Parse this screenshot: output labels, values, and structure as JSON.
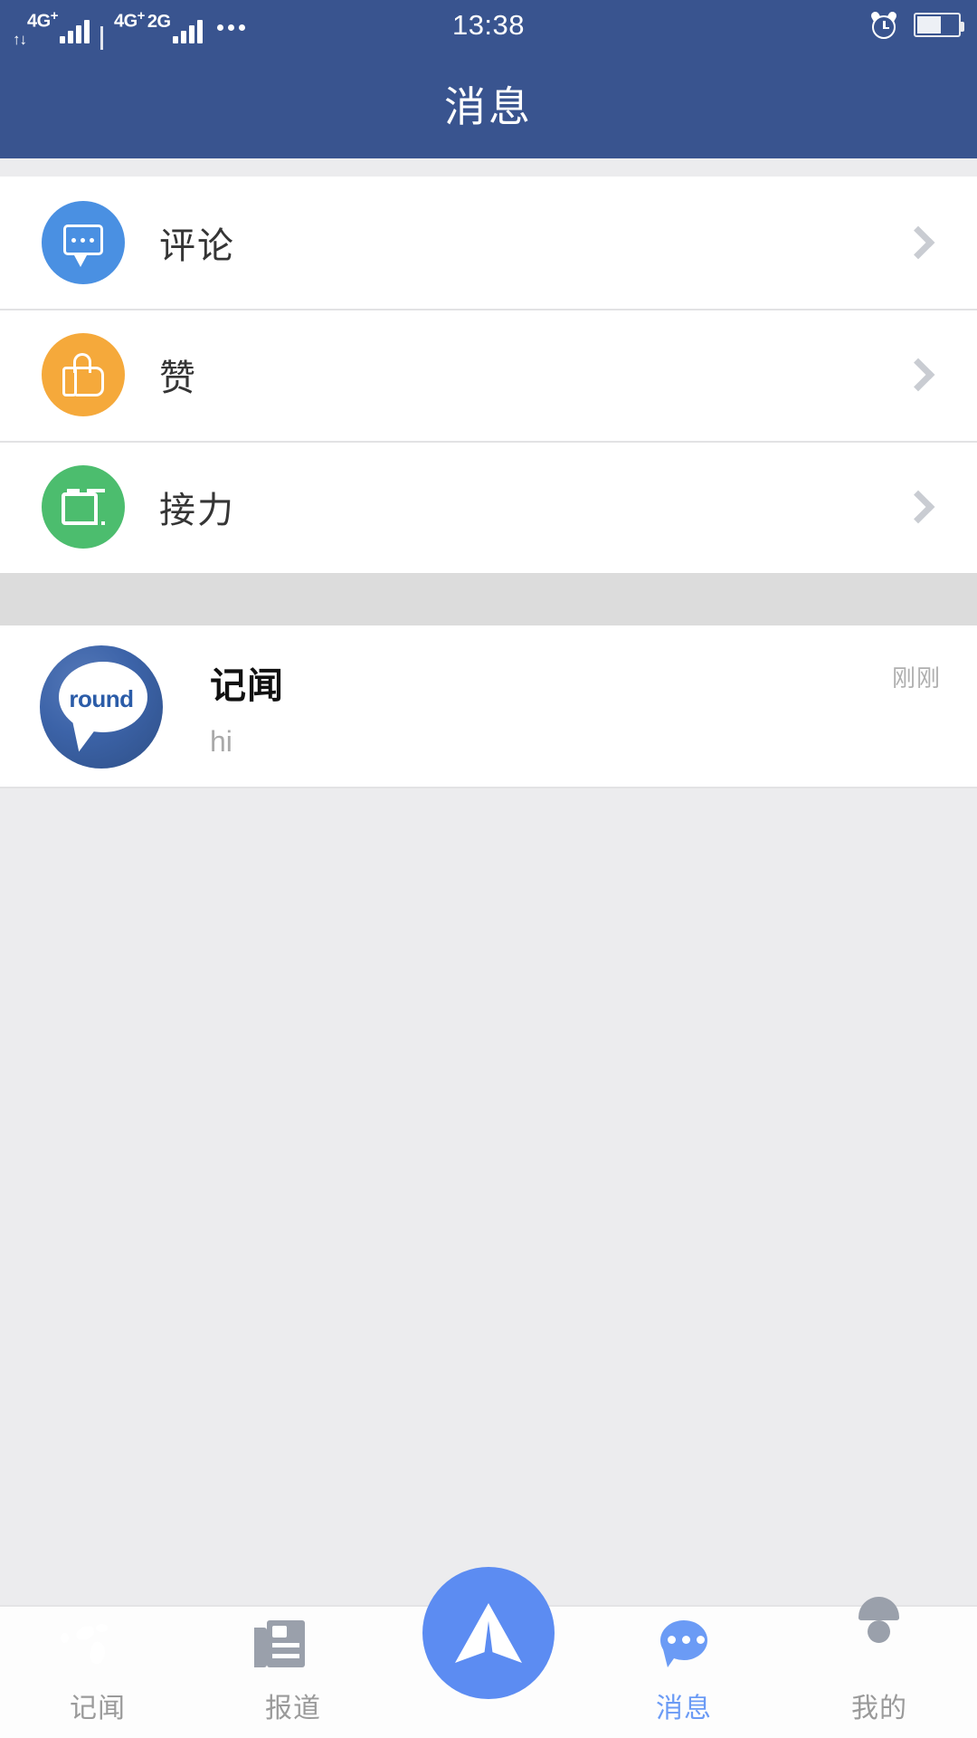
{
  "statusbar": {
    "networks": [
      {
        "label": "4G",
        "sup": "+",
        "icon": "signal-bars-icon"
      },
      {
        "label": "4G",
        "sup": "+",
        "icon": "signal-bars-icon"
      },
      {
        "label": "2G",
        "sup": "",
        "icon": "signal-bars-icon"
      }
    ],
    "data_arrows": "↑↓",
    "overflow_icon": "more-dots-icon",
    "time": "13:38",
    "alarm_icon": "alarm-clock-icon",
    "battery_icon": "battery-icon",
    "battery_percent": 55
  },
  "header": {
    "title": "消息",
    "background": "#39548F"
  },
  "categories": [
    {
      "label": "评论",
      "icon": "comment-icon",
      "color": "#4A90E2",
      "chevron": "chevron-right-icon"
    },
    {
      "label": "赞",
      "icon": "thumbs-up-icon",
      "color": "#F5A93B",
      "chevron": "chevron-right-icon"
    },
    {
      "label": "接力",
      "icon": "relay-icon",
      "color": "#4CBD6E",
      "chevron": "chevron-right-icon"
    }
  ],
  "conversations": [
    {
      "avatar_text": "round",
      "avatar_icon": "round-logo-avatar",
      "name": "记闻",
      "preview": "hi",
      "time": "刚刚"
    }
  ],
  "tabbar": {
    "items": [
      {
        "label": "记闻",
        "icon": "globe-icon",
        "active": false
      },
      {
        "label": "报道",
        "icon": "newspaper-icon",
        "active": false
      },
      {
        "label": "",
        "icon": "paper-plane-icon",
        "active": false
      },
      {
        "label": "消息",
        "icon": "chat-bubble-icon",
        "active": true
      },
      {
        "label": "我的",
        "icon": "person-icon",
        "active": false
      }
    ],
    "active_color": "#6B9BF5",
    "inactive_color": "#9A9A9A",
    "fab_color": "#5C8CF2"
  }
}
